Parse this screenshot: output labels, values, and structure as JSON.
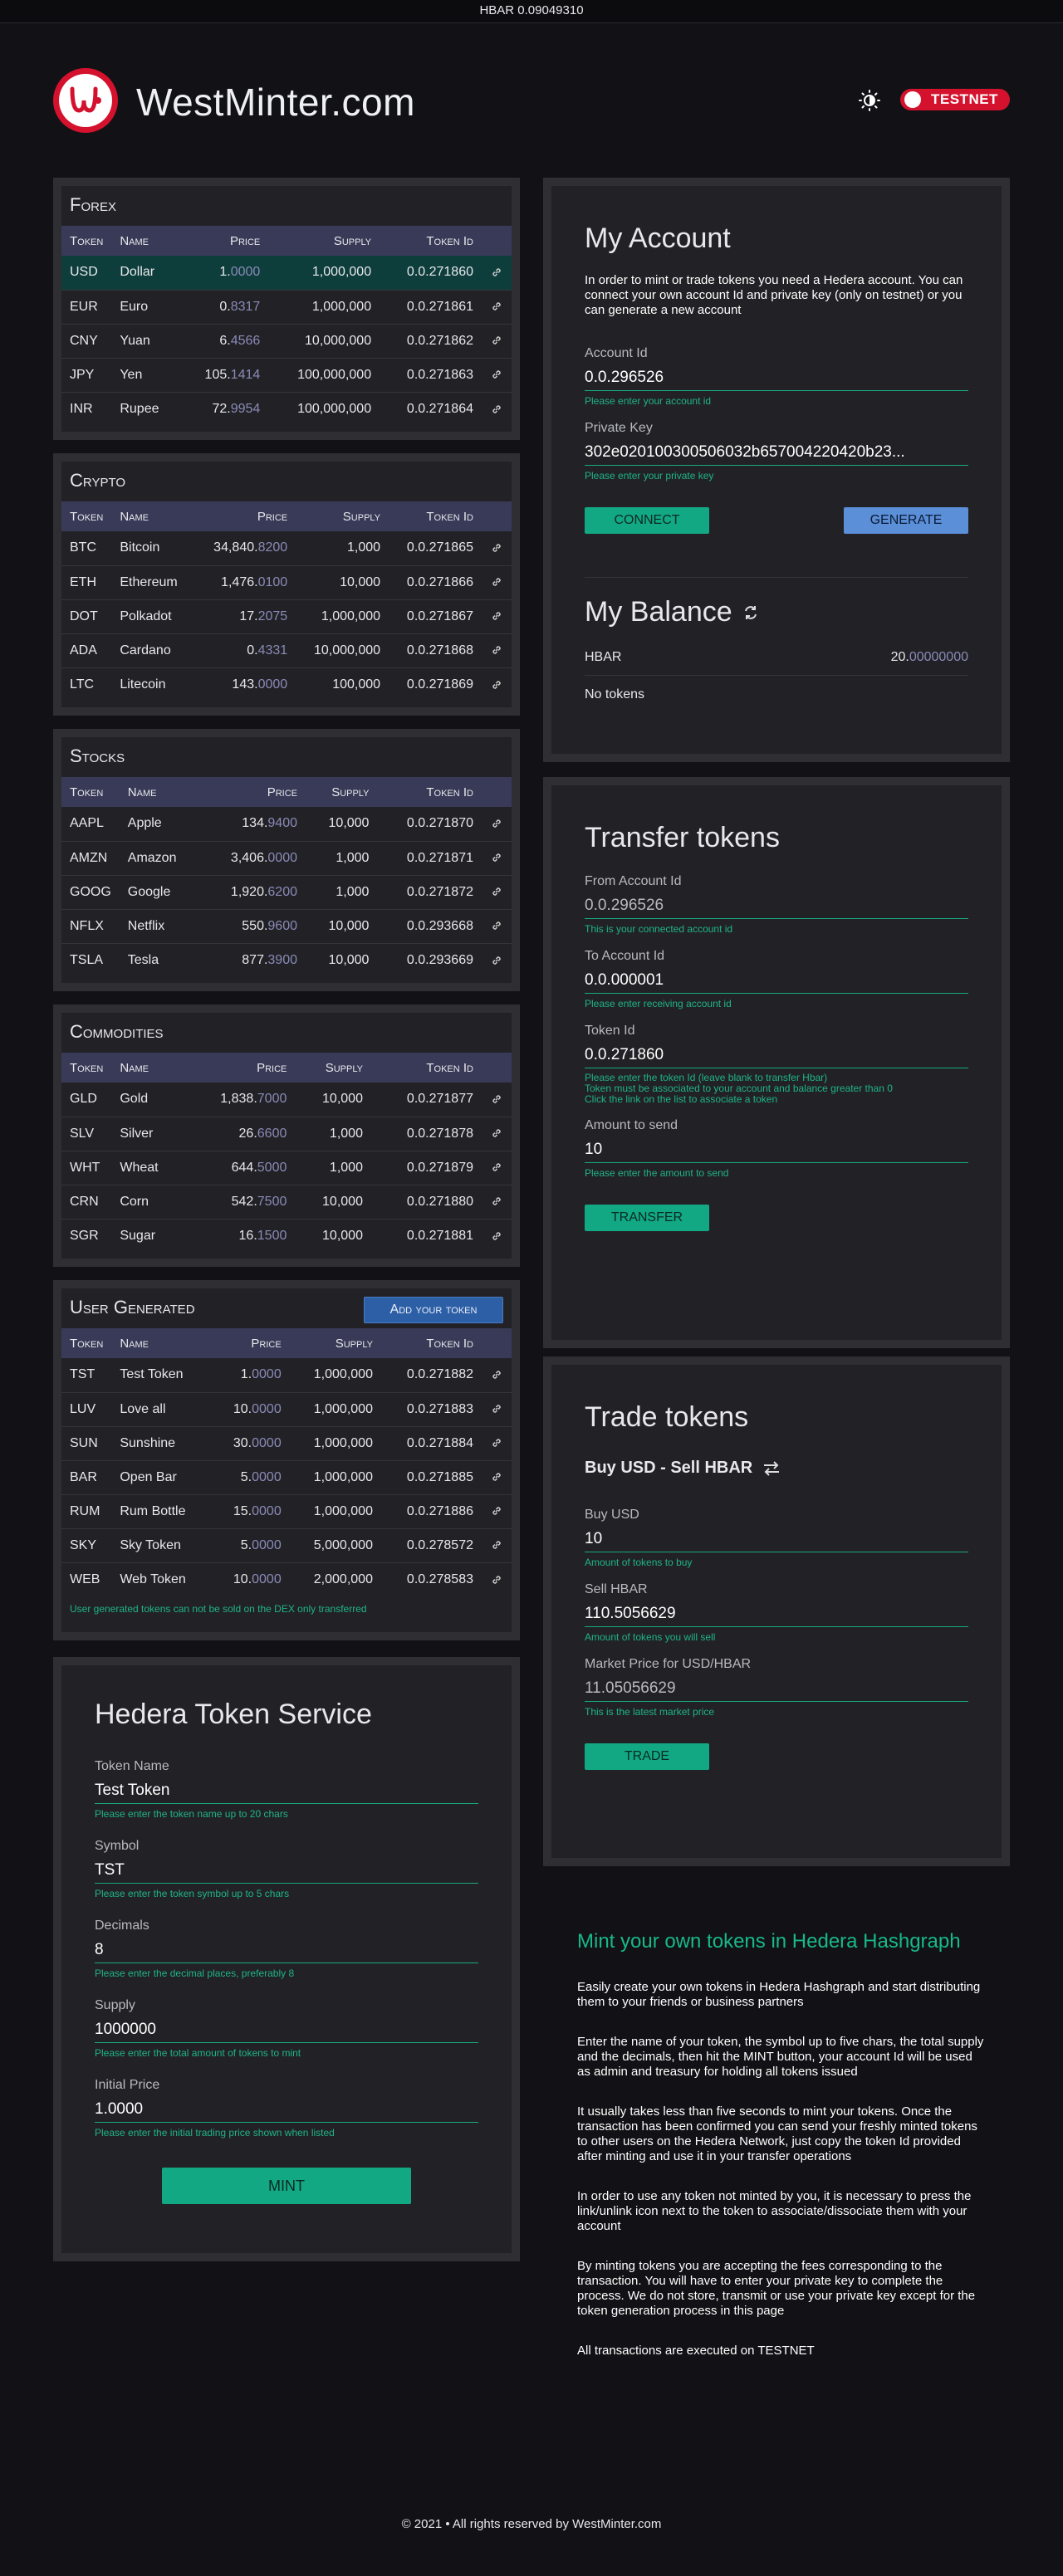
{
  "ticker": "HBAR 0.09049310",
  "brand": "WestMinter.com",
  "network_badge": "TESTNET",
  "colors": {
    "accent_green": "#12a884",
    "brand_red": "#d4122e",
    "header_purple": "#383a57",
    "button_blue": "#5b8fd8"
  },
  "table_headers": {
    "token": "Token",
    "name": "Name",
    "price": "Price",
    "supply": "Supply",
    "token_id": "Token Id"
  },
  "forex": {
    "title": "Forex",
    "rows": [
      {
        "token": "USD",
        "name": "Dollar",
        "price_int": "1.",
        "price_dec": "0000",
        "supply": "1,000,000",
        "id": "0.0.271860"
      },
      {
        "token": "EUR",
        "name": "Euro",
        "price_int": "0.",
        "price_dec": "8317",
        "supply": "1,000,000",
        "id": "0.0.271861"
      },
      {
        "token": "CNY",
        "name": "Yuan",
        "price_int": "6.",
        "price_dec": "4566",
        "supply": "10,000,000",
        "id": "0.0.271862"
      },
      {
        "token": "JPY",
        "name": "Yen",
        "price_int": "105.",
        "price_dec": "1414",
        "supply": "100,000,000",
        "id": "0.0.271863"
      },
      {
        "token": "INR",
        "name": "Rupee",
        "price_int": "72.",
        "price_dec": "9954",
        "supply": "100,000,000",
        "id": "0.0.271864"
      }
    ]
  },
  "crypto": {
    "title": "Crypto",
    "rows": [
      {
        "token": "BTC",
        "name": "Bitcoin",
        "price_int": "34,840.",
        "price_dec": "8200",
        "supply": "1,000",
        "id": "0.0.271865"
      },
      {
        "token": "ETH",
        "name": "Ethereum",
        "price_int": "1,476.",
        "price_dec": "0100",
        "supply": "10,000",
        "id": "0.0.271866"
      },
      {
        "token": "DOT",
        "name": "Polkadot",
        "price_int": "17.",
        "price_dec": "2075",
        "supply": "1,000,000",
        "id": "0.0.271867"
      },
      {
        "token": "ADA",
        "name": "Cardano",
        "price_int": "0.",
        "price_dec": "4331",
        "supply": "10,000,000",
        "id": "0.0.271868"
      },
      {
        "token": "LTC",
        "name": "Litecoin",
        "price_int": "143.",
        "price_dec": "0000",
        "supply": "100,000",
        "id": "0.0.271869"
      }
    ]
  },
  "stocks": {
    "title": "Stocks",
    "rows": [
      {
        "token": "AAPL",
        "name": "Apple",
        "price_int": "134.",
        "price_dec": "9400",
        "supply": "10,000",
        "id": "0.0.271870"
      },
      {
        "token": "AMZN",
        "name": "Amazon",
        "price_int": "3,406.",
        "price_dec": "0000",
        "supply": "1,000",
        "id": "0.0.271871"
      },
      {
        "token": "GOOG",
        "name": "Google",
        "price_int": "1,920.",
        "price_dec": "6200",
        "supply": "1,000",
        "id": "0.0.271872"
      },
      {
        "token": "NFLX",
        "name": "Netflix",
        "price_int": "550.",
        "price_dec": "9600",
        "supply": "10,000",
        "id": "0.0.293668"
      },
      {
        "token": "TSLA",
        "name": "Tesla",
        "price_int": "877.",
        "price_dec": "3900",
        "supply": "10,000",
        "id": "0.0.293669"
      }
    ]
  },
  "commodities": {
    "title": "Commodities",
    "rows": [
      {
        "token": "GLD",
        "name": "Gold",
        "price_int": "1,838.",
        "price_dec": "7000",
        "supply": "10,000",
        "id": "0.0.271877"
      },
      {
        "token": "SLV",
        "name": "Silver",
        "price_int": "26.",
        "price_dec": "6600",
        "supply": "1,000",
        "id": "0.0.271878"
      },
      {
        "token": "WHT",
        "name": "Wheat",
        "price_int": "644.",
        "price_dec": "5000",
        "supply": "1,000",
        "id": "0.0.271879"
      },
      {
        "token": "CRN",
        "name": "Corn",
        "price_int": "542.",
        "price_dec": "7500",
        "supply": "10,000",
        "id": "0.0.271880"
      },
      {
        "token": "SGR",
        "name": "Sugar",
        "price_int": "16.",
        "price_dec": "1500",
        "supply": "10,000",
        "id": "0.0.271881"
      }
    ]
  },
  "user_generated": {
    "title": "User Generated",
    "add_button": "Add your token",
    "note": "User generated tokens can not be sold on the DEX only transferred",
    "rows": [
      {
        "token": "TST",
        "name": "Test Token",
        "price_int": "1.",
        "price_dec": "0000",
        "supply": "1,000,000",
        "id": "0.0.271882"
      },
      {
        "token": "LUV",
        "name": "Love all",
        "price_int": "10.",
        "price_dec": "0000",
        "supply": "1,000,000",
        "id": "0.0.271883"
      },
      {
        "token": "SUN",
        "name": "Sunshine",
        "price_int": "30.",
        "price_dec": "0000",
        "supply": "1,000,000",
        "id": "0.0.271884"
      },
      {
        "token": "BAR",
        "name": "Open Bar",
        "price_int": "5.",
        "price_dec": "0000",
        "supply": "1,000,000",
        "id": "0.0.271885"
      },
      {
        "token": "RUM",
        "name": "Rum Bottle",
        "price_int": "15.",
        "price_dec": "0000",
        "supply": "1,000,000",
        "id": "0.0.271886"
      },
      {
        "token": "SKY",
        "name": "Sky Token",
        "price_int": "5.",
        "price_dec": "0000",
        "supply": "5,000,000",
        "id": "0.0.278572"
      },
      {
        "token": "WEB",
        "name": "Web Token",
        "price_int": "10.",
        "price_dec": "0000",
        "supply": "2,000,000",
        "id": "0.0.278583"
      }
    ]
  },
  "hts": {
    "title": "Hedera Token Service",
    "fields": [
      {
        "label": "Token Name",
        "value": "Test Token",
        "hint": "Please enter the token name up to 20 chars"
      },
      {
        "label": "Symbol",
        "value": "TST",
        "hint": "Please enter the token symbol up to 5 chars"
      },
      {
        "label": "Decimals",
        "value": "8",
        "hint": "Please enter the decimal places, preferably 8"
      },
      {
        "label": "Supply",
        "value": "1000000",
        "hint": "Please enter the total amount of tokens to mint"
      },
      {
        "label": "Initial Price",
        "value": "1.0000",
        "hint": "Please enter the initial trading price shown when listed"
      }
    ],
    "mint_button": "MINT"
  },
  "account": {
    "title": "My Account",
    "intro": "In order to mint or trade tokens you need a Hedera account. You can connect your own account Id and private key (only on testnet) or you can generate a new account",
    "account_id_label": "Account Id",
    "account_id_value": "0.0.296526",
    "account_id_hint": "Please enter your account id",
    "private_key_label": "Private Key",
    "private_key_value": "302e020100300506032b657004220420b23...",
    "private_key_hint": "Please enter your private key",
    "connect_button": "CONNECT",
    "generate_button": "GENERATE",
    "balance_title": "My Balance",
    "balance_label": "HBAR",
    "balance_int": "20.",
    "balance_dec": "00000000",
    "no_tokens": "No tokens"
  },
  "transfer": {
    "title": "Transfer tokens",
    "from_label": "From Account Id",
    "from_value": "0.0.296526",
    "from_hint": "This is your connected account id",
    "to_label": "To Account Id",
    "to_value": "0.0.000001",
    "to_hint": "Please enter receiving account id",
    "token_label": "Token Id",
    "token_value": "0.0.271860",
    "token_hint_1": "Please enter the token Id (leave blank to transfer Hbar)",
    "token_hint_2": "Token must be associated to your account and balance greater than 0",
    "token_hint_3": "Click the link on the list to associate a token",
    "amount_label": "Amount to send",
    "amount_value": "10",
    "amount_hint": "Please enter the amount to send",
    "button": "TRANSFER"
  },
  "trade": {
    "title": "Trade tokens",
    "pair": "Buy USD - Sell HBAR",
    "buy_label": "Buy USD",
    "buy_value": "10",
    "buy_hint": "Amount of tokens to buy",
    "sell_label": "Sell HBAR",
    "sell_value": "110.5056629",
    "sell_hint": "Amount of tokens you will sell",
    "market_label": "Market Price for USD/HBAR",
    "market_value": "11.05056629",
    "market_hint": "This is the latest market price",
    "button": "TRADE"
  },
  "info": {
    "title": "Mint your own tokens in Hedera Hashgraph",
    "paragraphs": [
      "Easily create your own tokens in Hedera Hashgraph and start distributing them to your friends or business partners",
      "Enter the name of your token, the symbol up to five chars, the total supply and the decimals, then hit the MINT button, your account Id will be used as admin and treasury for holding all tokens issued",
      "It usually takes less than five seconds to mint your tokens. Once the transaction has been confirmed you can send your freshly minted tokens to other users on the Hedera Network, just copy the token Id provided after minting and use it in your transfer operations",
      "In order to use any token not minted by you, it is necessary to press the link/unlink icon next to the token to associate/dissociate them with your account",
      "By minting tokens you are accepting the fees corresponding to the transaction. You will have to enter your private key to complete the process. We do not store, transmit or use your private key except for the token generation process in this page",
      "All transactions are executed on TESTNET"
    ]
  },
  "footer": "© 2021 • All rights reserved by WestMinter.com"
}
